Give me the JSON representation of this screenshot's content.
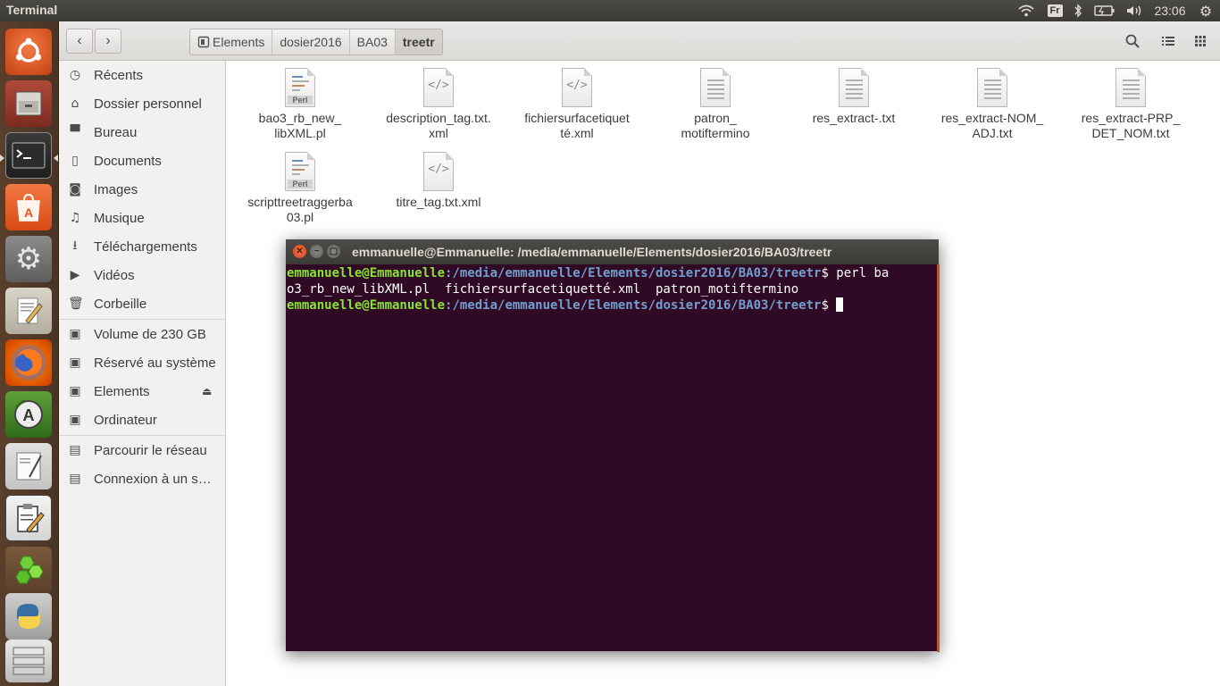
{
  "top_panel": {
    "app_title": "Terminal",
    "keyboard_layout": "Fr",
    "clock": "23:06",
    "icons": [
      "wifi-icon",
      "keyboard-layout-indicator",
      "bluetooth-icon",
      "battery-icon",
      "volume-icon",
      "settings-gear-icon"
    ]
  },
  "launcher": {
    "items": [
      {
        "name": "ubuntu-dash-icon",
        "color": "#e95420"
      },
      {
        "name": "files-icon",
        "color": "#9a3a2d"
      },
      {
        "name": "terminal-icon",
        "color": "#2b2b2b"
      },
      {
        "name": "software-center-icon",
        "color": "#e95420"
      },
      {
        "name": "system-settings-icon",
        "color": "#6d6d6d"
      },
      {
        "name": "text-editor-icon",
        "color": "#b8b4a8"
      },
      {
        "name": "firefox-icon",
        "color": "#e66000"
      },
      {
        "name": "software-updater-icon",
        "color": "#4a8a2a"
      },
      {
        "name": "notes-icon",
        "color": "#d8d8d8"
      },
      {
        "name": "clipboard-editor-icon",
        "color": "#e9e9e9"
      },
      {
        "name": "green-hexagons-icon",
        "color": "#6fbf3a"
      },
      {
        "name": "python-icon",
        "color": "#3a6ea5"
      },
      {
        "name": "drive-stack-icon",
        "color": "#cfcfcf"
      }
    ]
  },
  "header": {
    "breadcrumbs": [
      "Elements",
      "dosier2016",
      "BA03",
      "treetr"
    ]
  },
  "sidebar": {
    "items": [
      {
        "label": "Récents",
        "icon": "clock-icon"
      },
      {
        "label": "Dossier personnel",
        "icon": "home-icon"
      },
      {
        "label": "Bureau",
        "icon": "folder-icon"
      },
      {
        "label": "Documents",
        "icon": "document-icon"
      },
      {
        "label": "Images",
        "icon": "camera-icon"
      },
      {
        "label": "Musique",
        "icon": "music-icon"
      },
      {
        "label": "Téléchargements",
        "icon": "download-icon"
      },
      {
        "label": "Vidéos",
        "icon": "video-icon"
      },
      {
        "label": "Corbeille",
        "icon": "trash-icon"
      },
      {
        "label": "Volume de 230 GB",
        "icon": "drive-icon"
      },
      {
        "label": "Réservé au système",
        "icon": "drive-icon"
      },
      {
        "label": "Elements",
        "icon": "drive-icon"
      },
      {
        "label": "Ordinateur",
        "icon": "drive-icon"
      },
      {
        "label": "Parcourir le réseau",
        "icon": "network-icon"
      },
      {
        "label": "Connexion à un serveur",
        "icon": "network-icon"
      }
    ]
  },
  "files": [
    {
      "line1": "bao3_rb_new_",
      "line2": "libXML.pl",
      "type": "perl"
    },
    {
      "line1": "description_tag.txt.",
      "line2": "xml",
      "type": "xml"
    },
    {
      "line1": "fichiersurfacetiquet",
      "line2": "té.xml",
      "type": "xml"
    },
    {
      "line1": "patron_",
      "line2": "motiftermino",
      "type": "text"
    },
    {
      "line1": "res_extract-.txt",
      "line2": "",
      "type": "text"
    },
    {
      "line1": "res_extract-NOM_",
      "line2": "ADJ.txt",
      "type": "text"
    },
    {
      "line1": "res_extract-PRP_",
      "line2": "DET_NOM.txt",
      "type": "text"
    },
    {
      "line1": "scripttreetraggerba",
      "line2": "03.pl",
      "type": "perl"
    },
    {
      "line1": "titre_tag.txt.xml",
      "line2": "",
      "type": "xml"
    }
  ],
  "terminal": {
    "title": "emmanuelle@Emmanuelle: /media/emmanuelle/Elements/dosier2016/BA03/treetr",
    "user": "emmanuelle@Emmanuelle",
    "path": ":/media/emmanuelle/Elements/dosier2016/BA03/treetr",
    "line1_cmd": "$ perl ba",
    "line2": "o3_rb_new_libXML.pl  fichiersurfacetiquetté.xml  patron_motiftermino",
    "line3_cmd": "$ ",
    "colors": {
      "background": "#300a24",
      "user": "#8ae234",
      "path": "#729fcf",
      "accent": "#dd4814"
    }
  }
}
